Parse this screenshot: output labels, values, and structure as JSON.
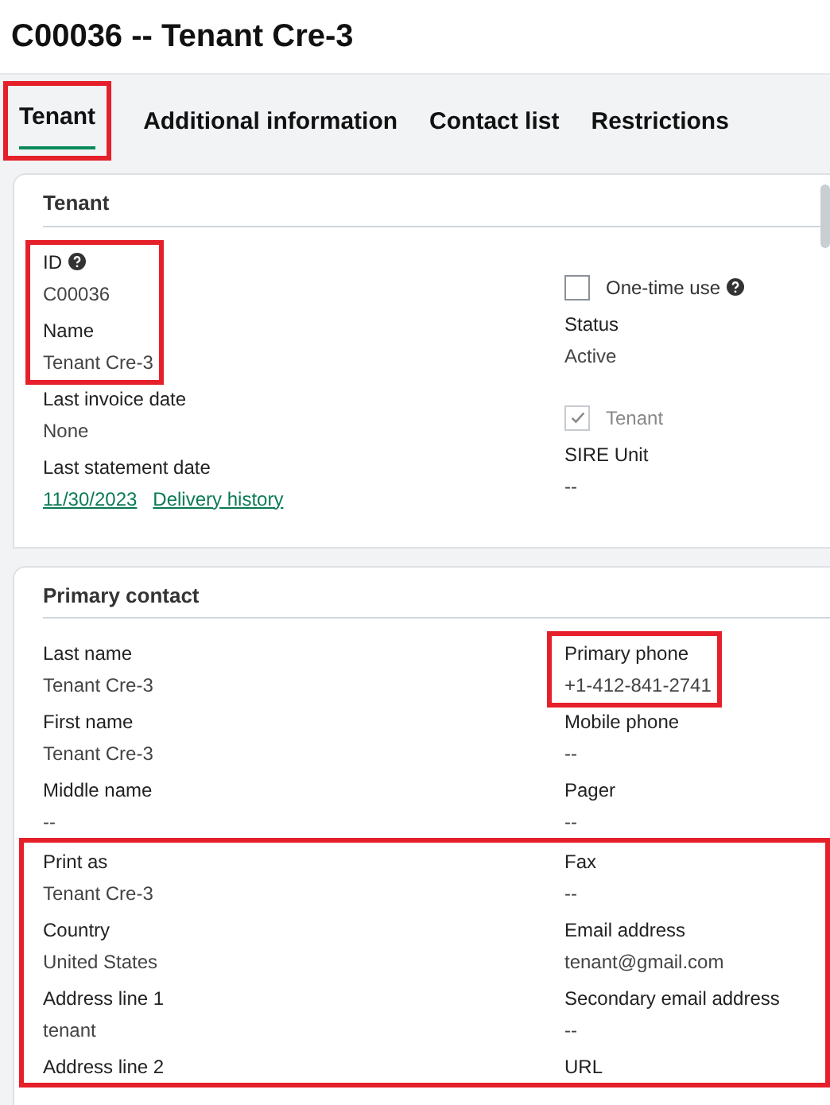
{
  "page_title": "C00036 -- Tenant Cre-3",
  "tabs": [
    {
      "label": "Tenant",
      "selected": true,
      "highlighted": true
    },
    {
      "label": "Additional information",
      "selected": false
    },
    {
      "label": "Contact list",
      "selected": false
    },
    {
      "label": "Restrictions",
      "selected": false
    }
  ],
  "cards": [
    {
      "title": "Tenant",
      "blocks": [
        {
          "columns": [
            [
              {
                "highlighted": true,
                "fields": [
                  {
                    "kind": "field",
                    "label": "ID",
                    "help": true,
                    "value": "C00036"
                  },
                  {
                    "kind": "field",
                    "label": "Name",
                    "value": "Tenant Cre-3"
                  }
                ]
              },
              {
                "fields": [
                  {
                    "kind": "field",
                    "label": "Last invoice date",
                    "value": "None"
                  },
                  {
                    "kind": "field",
                    "label": "Last statement date",
                    "links": [
                      "11/30/2023",
                      "Delivery history"
                    ]
                  }
                ]
              }
            ],
            [
              {
                "fields": [
                  {
                    "kind": "checkbox",
                    "label": "One-time use",
                    "checked": false,
                    "disabled": false,
                    "help": true
                  },
                  {
                    "kind": "field",
                    "label": "Status",
                    "value": "Active"
                  },
                  {
                    "kind": "checkbox",
                    "label": "Tenant",
                    "checked": true,
                    "disabled": true
                  },
                  {
                    "kind": "field",
                    "label": "SIRE Unit",
                    "value": "--"
                  }
                ]
              }
            ]
          ]
        }
      ]
    },
    {
      "title": "Primary contact",
      "blocks": [
        {
          "columns": [
            [
              {
                "fields": [
                  {
                    "kind": "field",
                    "label": "Last name",
                    "value": "Tenant Cre-3"
                  },
                  {
                    "kind": "field",
                    "label": "First name",
                    "value": "Tenant Cre-3"
                  },
                  {
                    "kind": "field",
                    "label": "Middle name",
                    "value": "--"
                  }
                ]
              }
            ],
            [
              {
                "highlighted": true,
                "fields": [
                  {
                    "kind": "field",
                    "label": "Primary phone",
                    "value": "+1-412-841-2741"
                  }
                ]
              },
              {
                "fields": [
                  {
                    "kind": "field",
                    "label": "Mobile phone",
                    "value": "--"
                  },
                  {
                    "kind": "field",
                    "label": "Pager",
                    "value": "--"
                  }
                ]
              }
            ]
          ]
        },
        {
          "highlighted": true,
          "columns": [
            [
              {
                "fields": [
                  {
                    "kind": "field",
                    "label": "Print as",
                    "value": "Tenant Cre-3"
                  },
                  {
                    "kind": "field",
                    "label": "Country",
                    "value": "United States"
                  },
                  {
                    "kind": "field",
                    "label": "Address line 1",
                    "value": "tenant"
                  },
                  {
                    "kind": "field",
                    "label": "Address line 2"
                  }
                ]
              }
            ],
            [
              {
                "fields": [
                  {
                    "kind": "field",
                    "label": "Fax",
                    "value": "--"
                  },
                  {
                    "kind": "field",
                    "label": "Email address",
                    "value": "tenant@gmail.com"
                  },
                  {
                    "kind": "field",
                    "label": "Secondary email address",
                    "value": "--"
                  },
                  {
                    "kind": "field",
                    "label": "URL"
                  }
                ]
              }
            ]
          ]
        }
      ]
    }
  ]
}
